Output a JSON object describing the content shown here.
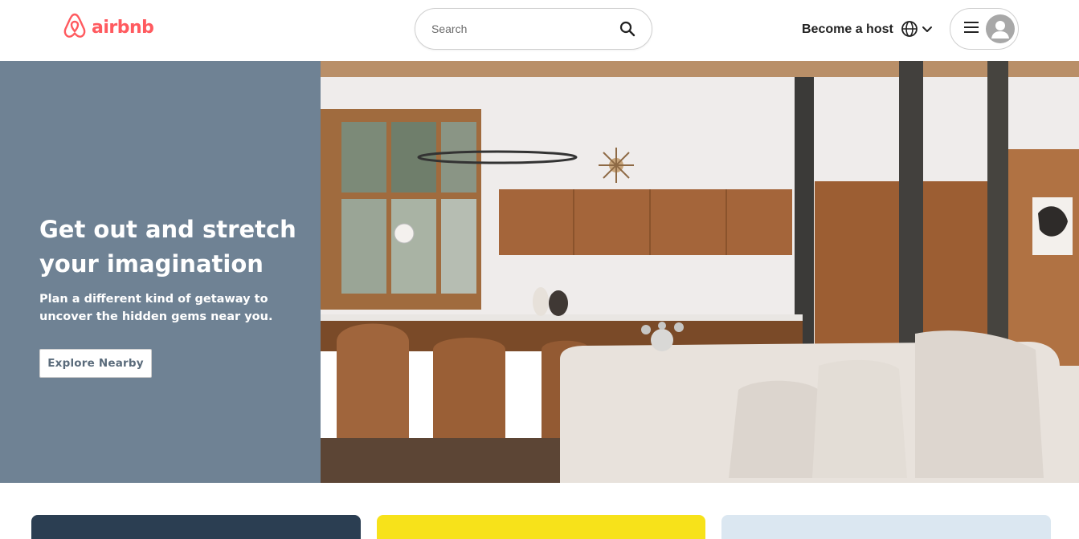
{
  "header": {
    "logo_text": "airbnb",
    "logo_icon": "airbnb-belo-icon",
    "search": {
      "placeholder": "Search",
      "icon": "search-icon"
    },
    "host_link": "Become a host",
    "language_icon": "globe-icon",
    "language_chevron": "chevron-down-icon",
    "menu_icon": "hamburger-menu-icon",
    "avatar_icon": "user-avatar-icon"
  },
  "hero": {
    "title": "Get out and stretch your imagination",
    "subtitle": "Plan a different kind of getaway to uncover the hidden gems near you.",
    "cta_label": "Explore Nearby",
    "image_alt": "modern living room and kitchen interior",
    "panel_color": "#6f8294"
  },
  "cards": [
    {
      "color": "#2b3e52"
    },
    {
      "color": "#f7e21a"
    },
    {
      "color": "#dbe7f1"
    }
  ],
  "brand_color": "#ff5a5f"
}
